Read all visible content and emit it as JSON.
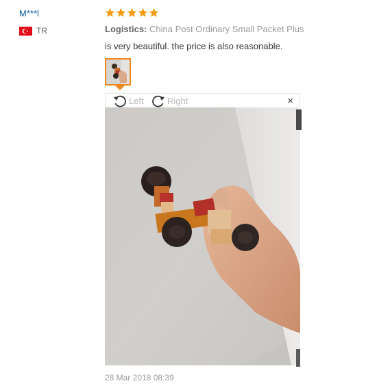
{
  "review": {
    "user_name": "M***l",
    "country_code": "TR",
    "rating": 5,
    "logistics_label": "Logistics:",
    "logistics_value": "China Post Ordinary Small Packet Plus",
    "comment": "is very beautiful. the price is also reasonable.",
    "date": "28 Mar 2018 08:39"
  },
  "viewer": {
    "rotate_left_label": "Left",
    "rotate_right_label": "Right",
    "close_glyph": "×"
  },
  "icons": {
    "star": "star-icon",
    "flag": "turkey-flag-icon",
    "rotate_left": "rotate-left-icon",
    "rotate_right": "rotate-right-icon",
    "close": "close-icon"
  },
  "colors": {
    "star": "#f39c12",
    "user_link": "#0b5aa8",
    "thumb_border": "#f08a1f"
  }
}
